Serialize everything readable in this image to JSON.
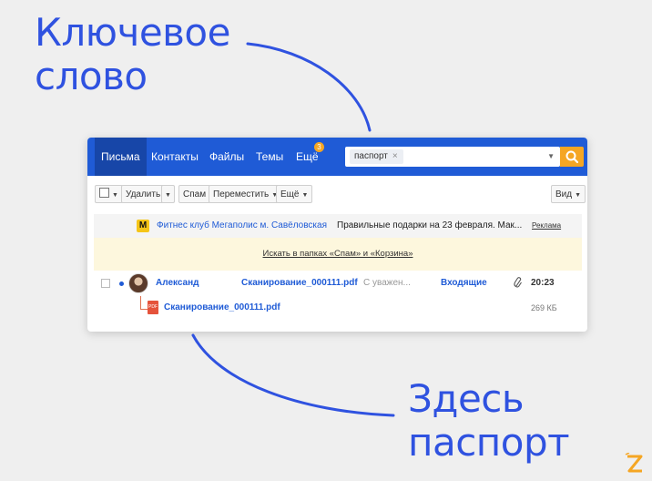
{
  "captions": {
    "top_line1": "Ключевое",
    "top_line2": "слово",
    "bottom_line1": "Здесь",
    "bottom_line2": "паспорт"
  },
  "colors": {
    "accent": "#2f52e0",
    "navbar": "#1f5bd6",
    "navbar_active": "#1746a8",
    "search_button": "#f5a623",
    "badge": "#f5a623",
    "info_background": "#fdf7dd"
  },
  "navbar": {
    "items": [
      {
        "label": "Письма",
        "active": true
      },
      {
        "label": "Контакты"
      },
      {
        "label": "Файлы"
      },
      {
        "label": "Темы"
      },
      {
        "label": "Ещё"
      }
    ],
    "more_badge": "3"
  },
  "search": {
    "chip": "паспорт",
    "chip_remove": "×",
    "dropdown_icon": "chevron-down-icon",
    "button_icon": "search-icon"
  },
  "toolbar": {
    "delete": "Удалить",
    "spam": "Спам",
    "move": "Переместить",
    "more": "Ещё",
    "view": "Вид"
  },
  "ad": {
    "logo": "М",
    "sender": "Фитнес клуб Мегаполис м. Савёловская",
    "subject": "Правильные подарки на 23 февраля. Мак...",
    "tag": "Реклама"
  },
  "search_notice": "Искать в папках «Спам» и «Корзина»",
  "mail": {
    "sender": "Александ",
    "subject": "Сканирование_000111.pdf",
    "snippet": "С уважен...",
    "folder": "Входящие",
    "time": "20:23",
    "attachment": {
      "icon_label": "PDF",
      "name": "Сканирование_000111.pdf",
      "size": "269 КБ"
    }
  }
}
